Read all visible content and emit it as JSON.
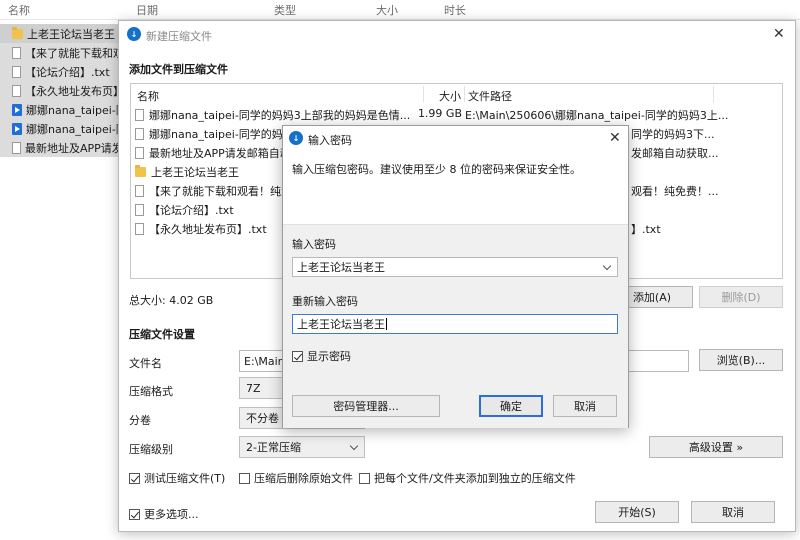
{
  "explorer": {
    "columns": {
      "name": "名称",
      "date": "日期",
      "type": "类型",
      "size": "大小",
      "duration": "时长"
    },
    "rows": [
      {
        "icon": "folder-icon",
        "text": "上老王论坛当老王"
      },
      {
        "icon": "document-icon",
        "text": "【来了就能下载和观"
      },
      {
        "icon": "document-icon",
        "text": "【论坛介绍】.txt"
      },
      {
        "icon": "document-icon",
        "text": "【永久地址发布页】."
      },
      {
        "icon": "video-icon",
        "text": "娜娜nana_taipei-同"
      },
      {
        "icon": "video-icon",
        "text": "娜娜nana_taipei-同"
      },
      {
        "icon": "document-icon",
        "text": "最新地址及APP请发"
      }
    ]
  },
  "main_dialog": {
    "title": "新建压缩文件",
    "add_section_title": "添加文件到压缩文件",
    "table_headers": {
      "name": "名称",
      "size": "大小",
      "path": "文件路径"
    },
    "files": [
      {
        "icon": "document-icon",
        "name": "娜娜nana_taipei-同学的妈妈3上部我的妈妈是色情...",
        "size": "1.99 GB",
        "path": "E:\\Main\\250606\\娜娜nana_taipei-同学的妈妈3上..."
      },
      {
        "icon": "document-icon",
        "name": "娜娜nana_taipei-同学的妈妈3",
        "size": "",
        "path": "同学的妈妈3下..."
      },
      {
        "icon": "document-icon",
        "name": "最新地址及APP请发邮箱自动获",
        "size": "",
        "path": "发邮箱自动获取..."
      },
      {
        "icon": "folder-icon",
        "name": "上老王论坛当老王",
        "size": "",
        "path": ""
      },
      {
        "icon": "document-icon",
        "name": "【来了就能下载和观看！纯免费",
        "size": "",
        "path": "观看！纯免费！..."
      },
      {
        "icon": "document-icon",
        "name": "【论坛介绍】.txt",
        "size": "",
        "path": ""
      },
      {
        "icon": "document-icon",
        "name": "【永久地址发布页】.txt",
        "size": "",
        "path": "】.txt"
      }
    ],
    "total_size": "总大小: 4.02 GB",
    "add_button": "添加(A)",
    "delete_button": "删除(D)",
    "settings_title": "压缩文件设置",
    "filename_label": "文件名",
    "filename_value": "E:\\Main\\",
    "browse_button": "浏览(B)...",
    "format_label": "压缩格式",
    "format_value": "7Z",
    "split_label": "分卷",
    "split_value": "不分卷",
    "level_label": "压缩级别",
    "level_value": "2-正常压缩",
    "advanced_button": "高级设置 »",
    "check_test": "测试压缩文件(T)",
    "check_delete": "压缩后删除原始文件",
    "check_each": "把每个文件/文件夹添加到独立的压缩文件",
    "more_options": "更多选项...",
    "start_button": "开始(S)",
    "cancel_button": "取消"
  },
  "password_dialog": {
    "title": "输入密码",
    "description": "输入压缩包密码。建议使用至少 8 位的密码来保证安全性。",
    "enter_label": "输入密码",
    "enter_value": "上老王论坛当老王",
    "reenter_label": "重新输入密码",
    "reenter_value": "上老王论坛当老王",
    "show_password": "显示密码",
    "manager_button": "密码管理器...",
    "ok_button": "确定",
    "cancel_button": "取消"
  }
}
